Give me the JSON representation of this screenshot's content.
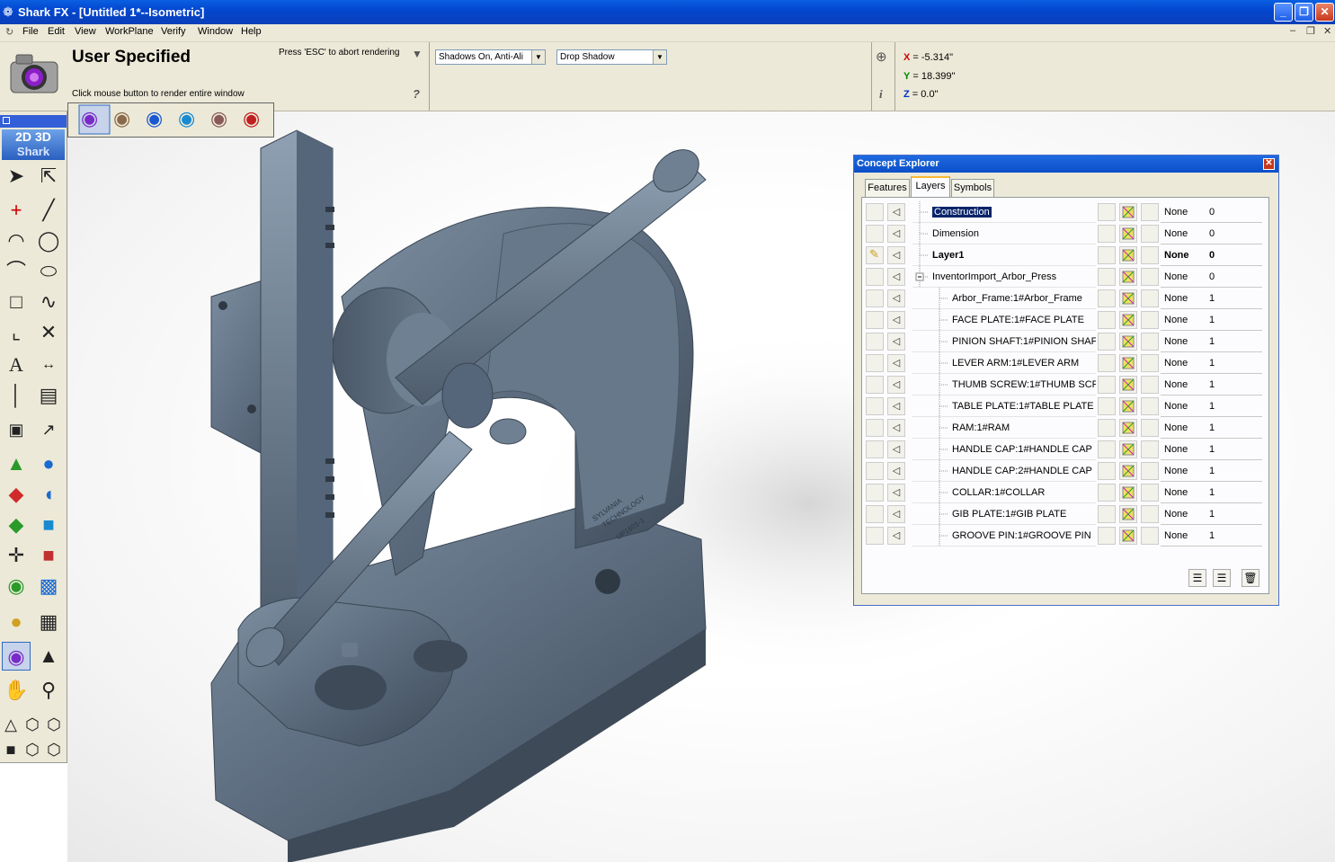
{
  "window": {
    "app": "Shark FX",
    "title": "Shark FX - [Untitled 1*--Isometric]"
  },
  "menu": [
    "File",
    "Edit",
    "View",
    "WorkPlane",
    "Verify",
    "Window",
    "Help"
  ],
  "toolbar": {
    "mode_title": "User Specified",
    "mode_hint": "Click mouse button to render entire window",
    "esc_hint": "Press 'ESC' to abort rendering",
    "help_glyph": "?",
    "shadows_combo": "Shadows On, Anti-Ali",
    "drop_shadow_combo": "Drop Shadow",
    "info_glyph": "i"
  },
  "coords": {
    "x_label": "X",
    "x_value": "= -5.314\"",
    "y_label": "Y",
    "y_value": "= 18.399\"",
    "z_label": "Z",
    "z_value": "= 0.0\""
  },
  "palette": {
    "logo_2d": "2D",
    "logo_3d": "3D",
    "logo_brand": "Shark"
  },
  "explorer": {
    "title": "Concept Explorer",
    "tabs": [
      "Features",
      "Layers",
      "Symbols"
    ],
    "active_tab": "Layers",
    "layers": [
      {
        "name": "Construction",
        "linetype": "None",
        "count": "0",
        "level": 0,
        "selected": true
      },
      {
        "name": "Dimension",
        "linetype": "None",
        "count": "0",
        "level": 0
      },
      {
        "name": "Layer1",
        "linetype": "None",
        "count": "0",
        "level": 0,
        "bold": true,
        "current": true
      },
      {
        "name": "InventorImport_Arbor_Press",
        "linetype": "None",
        "count": "0",
        "level": 0,
        "expanded": true
      },
      {
        "name": "Arbor_Frame:1#Arbor_Frame",
        "linetype": "None",
        "count": "1",
        "level": 1
      },
      {
        "name": "FACE PLATE:1#FACE PLATE",
        "linetype": "None",
        "count": "1",
        "level": 1
      },
      {
        "name": "PINION SHAFT:1#PINION SHAF",
        "linetype": "None",
        "count": "1",
        "level": 1
      },
      {
        "name": "LEVER ARM:1#LEVER ARM",
        "linetype": "None",
        "count": "1",
        "level": 1
      },
      {
        "name": "THUMB SCREW:1#THUMB SCF",
        "linetype": "None",
        "count": "1",
        "level": 1
      },
      {
        "name": "TABLE PLATE:1#TABLE PLATE",
        "linetype": "None",
        "count": "1",
        "level": 1
      },
      {
        "name": "RAM:1#RAM",
        "linetype": "None",
        "count": "1",
        "level": 1
      },
      {
        "name": "HANDLE CAP:1#HANDLE CAP",
        "linetype": "None",
        "count": "1",
        "level": 1
      },
      {
        "name": "HANDLE CAP:2#HANDLE CAP",
        "linetype": "None",
        "count": "1",
        "level": 1
      },
      {
        "name": "COLLAR:1#COLLAR",
        "linetype": "None",
        "count": "1",
        "level": 1
      },
      {
        "name": "GIB PLATE:1#GIB PLATE",
        "linetype": "None",
        "count": "1",
        "level": 1
      },
      {
        "name": "GROOVE PIN:1#GROOVE PIN",
        "linetype": "None",
        "count": "1",
        "level": 1
      }
    ]
  },
  "model": {
    "engraving_1": "SYLVANIA",
    "engraving_2": "TECHNOLOGY",
    "engraving_3": "UP1601-1"
  },
  "colors": {
    "titlebar": "#0a5fe0",
    "model": "#5f6f80",
    "selection": "#0a246a"
  }
}
